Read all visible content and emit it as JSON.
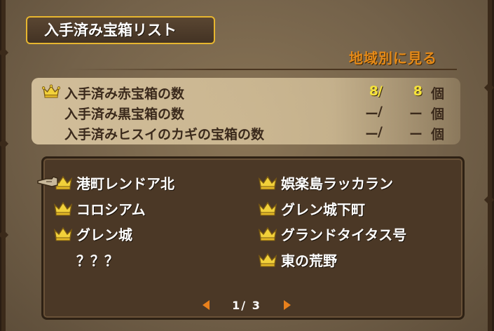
{
  "header": {
    "title": "入手済み宝箱リスト",
    "region_link": "地域別に見る"
  },
  "summary": [
    {
      "label": "入手済み赤宝箱の数",
      "got": "8",
      "slash": "/",
      "total": "8",
      "unit": "個",
      "crown": true
    },
    {
      "label": "入手済み黒宝箱の数",
      "got": "ー",
      "slash": "/",
      "total": "ー",
      "unit": "個",
      "crown": false
    },
    {
      "label": "入手済みヒスイのカギの宝箱の数",
      "got": "ー",
      "slash": "/",
      "total": "ー",
      "unit": "個",
      "crown": false
    }
  ],
  "locations": {
    "left": [
      {
        "name": "港町レンドア北",
        "crown": true
      },
      {
        "name": "コロシアム",
        "crown": true
      },
      {
        "name": "グレン城",
        "crown": true
      },
      {
        "name": "？？？",
        "crown": false
      }
    ],
    "right": [
      {
        "name": "娯楽島ラッカラン",
        "crown": true
      },
      {
        "name": "グレン城下町",
        "crown": true
      },
      {
        "name": "グランドタイタス号",
        "crown": true
      },
      {
        "name": "東の荒野",
        "crown": true
      }
    ]
  },
  "pager": {
    "text": "1/ 3"
  },
  "icons": {
    "crown": "crown-icon",
    "pointer": "hand-pointer-icon",
    "prev": "arrow-left-icon",
    "next": "arrow-right-icon"
  },
  "colors": {
    "title_border": "#e7b62f",
    "region_link": "#e58a18",
    "count_highlight": "#f6e43a",
    "crown": "#f2d13a"
  }
}
